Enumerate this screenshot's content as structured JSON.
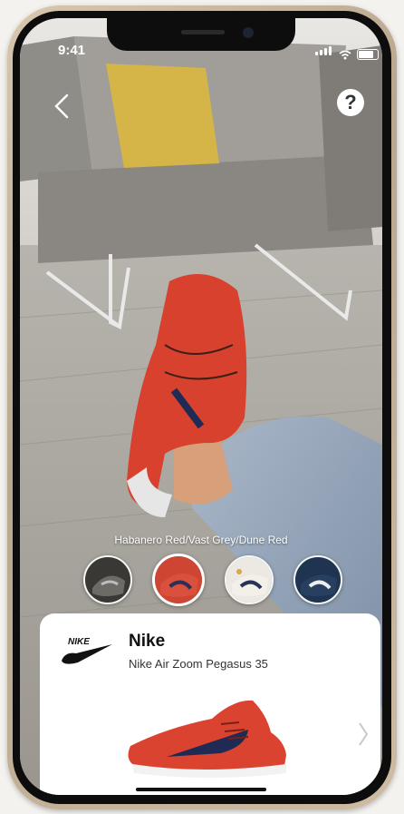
{
  "status_bar": {
    "time": "9:41"
  },
  "top_bar": {
    "back_icon": "chevron-left-icon",
    "help_label": "?"
  },
  "colorway": {
    "selected_label": "Habanero Red/Vast Grey/Dune Red"
  },
  "swatches": [
    {
      "name": "black-grey",
      "colors": [
        "#2b2b2b",
        "#8a8a8a"
      ]
    },
    {
      "name": "habanero-red",
      "colors": [
        "#d24532",
        "#2b2f55"
      ],
      "selected": true
    },
    {
      "name": "white-navy",
      "colors": [
        "#e8e4df",
        "#283456"
      ]
    },
    {
      "name": "navy-white",
      "colors": [
        "#1f3450",
        "#eeeeee"
      ]
    }
  ],
  "product": {
    "brand": "Nike",
    "model": "Nike Air Zoom Pegasus 35",
    "accent": "#d9432f"
  }
}
